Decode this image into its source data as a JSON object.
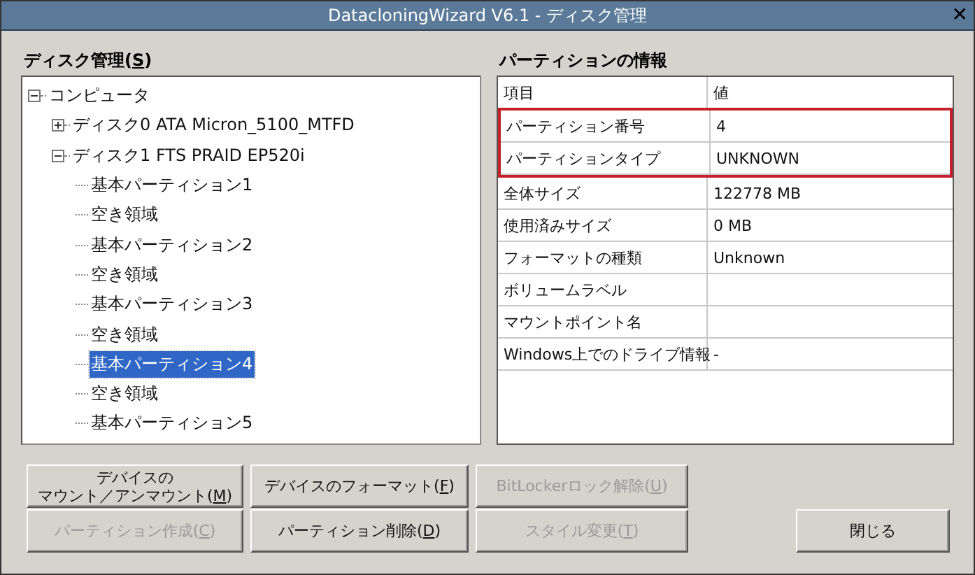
{
  "window": {
    "title": "DatacloningWizard V6.1 - ディスク管理",
    "close": "✕"
  },
  "disk_panel": {
    "label": {
      "text": "ディスク管理(",
      "accel": "S",
      "after": ")"
    },
    "tree": [
      {
        "label": "コンピュータ",
        "expanded": true,
        "selected": false,
        "children": [
          {
            "label": "ディスク0 ATA Micron_5100_MTFD",
            "expanded": false,
            "selected": false
          },
          {
            "label": "ディスク1 FTS PRAID EP520i",
            "expanded": true,
            "selected": false,
            "children": [
              {
                "label": "基本パーティション1",
                "selected": false
              },
              {
                "label": "空き領域",
                "selected": false
              },
              {
                "label": "基本パーティション2",
                "selected": false
              },
              {
                "label": "空き領域",
                "selected": false
              },
              {
                "label": "基本パーティション3",
                "selected": false
              },
              {
                "label": "空き領域",
                "selected": false
              },
              {
                "label": "基本パーティション4",
                "selected": true
              },
              {
                "label": "空き領域",
                "selected": false
              },
              {
                "label": "基本パーティション5",
                "selected": false
              }
            ]
          }
        ]
      }
    ]
  },
  "info_panel": {
    "label": "パーティションの情報",
    "columns": [
      "項目",
      "値"
    ],
    "rows": [
      {
        "item": "パーティション番号",
        "value": "4",
        "highlighted": true
      },
      {
        "item": "パーティションタイプ",
        "value": "UNKNOWN",
        "highlighted": true
      },
      {
        "item": "全体サイズ",
        "value": "122778 MB",
        "highlighted": false
      },
      {
        "item": "使用済みサイズ",
        "value": "0 MB",
        "highlighted": false
      },
      {
        "item": "フォーマットの種類",
        "value": "Unknown",
        "highlighted": false
      },
      {
        "item": "ボリュームラベル",
        "highlighted": false
      },
      {
        "item": "マウントポイント名",
        "highlighted": false
      },
      {
        "item": "Windows上でのドライブ情報",
        "value": "-",
        "highlighted": false
      }
    ]
  },
  "buttons": [
    [
      {
        "first_line": "デバイスの",
        "text": "マウント／アンマウント(",
        "accel": "M",
        "after": ")",
        "disabled": false
      },
      {
        "text": "デバイスのフォーマット(",
        "accel": "F",
        "after": ")",
        "disabled": false
      },
      {
        "text": "BitLockerロック解除(",
        "accel": "U",
        "after": ")",
        "disabled": true
      }
    ],
    [
      {
        "text": "パーティション作成(",
        "accel": "C",
        "after": ")",
        "disabled": true
      },
      {
        "text": "パーティション削除(",
        "accel": "D",
        "after": ")",
        "disabled": false
      },
      {
        "text": "スタイル変更(",
        "accel": "T",
        "after": ")",
        "disabled": true
      }
    ]
  ],
  "close_button": {
    "text": "閉じる",
    "disabled": false
  }
}
